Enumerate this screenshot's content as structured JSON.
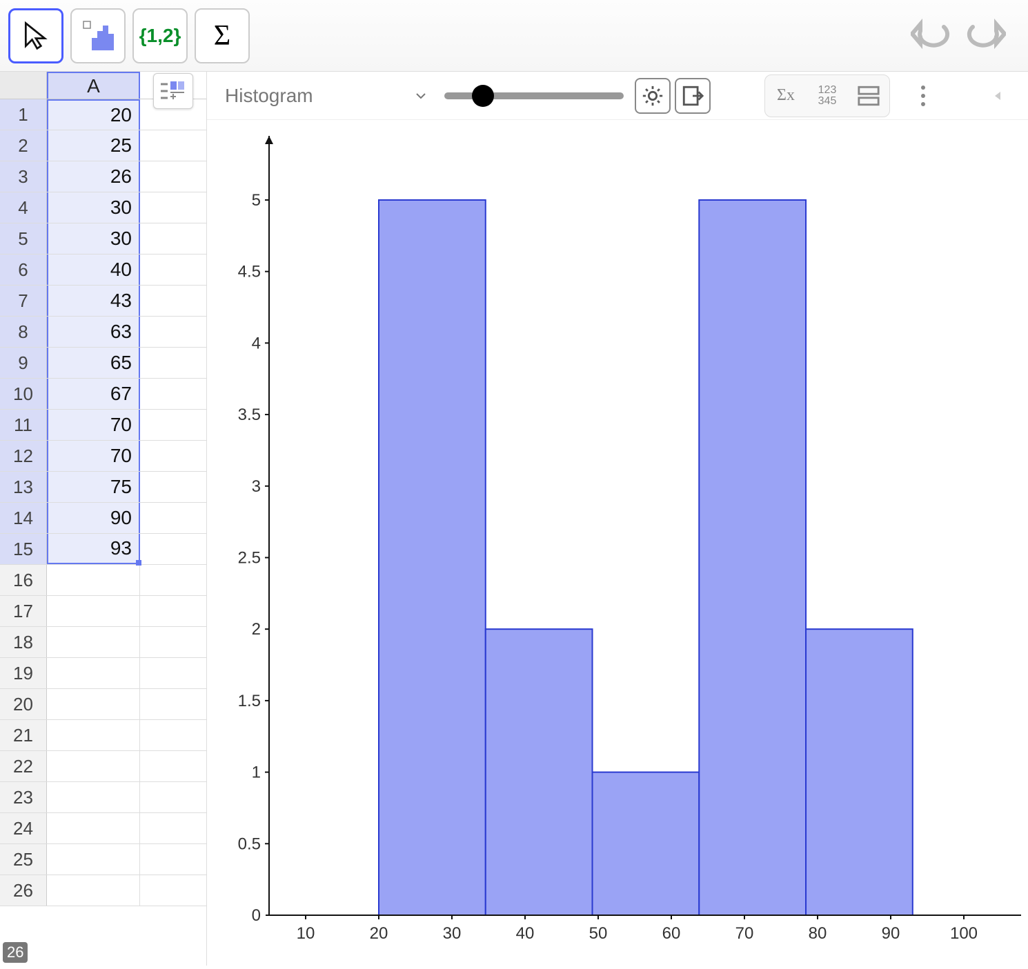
{
  "toolbar": {
    "move_tool": "move-tool",
    "histogram_tool": "one-variable-analysis",
    "list_tool": "{1,2}",
    "sigma_tool": "Σ"
  },
  "spreadsheet": {
    "column_header": "A",
    "visible_rows": 26,
    "selected_range_end": 15,
    "values": [
      20,
      25,
      26,
      30,
      30,
      40,
      43,
      63,
      65,
      67,
      70,
      70,
      75,
      90,
      93
    ],
    "row_tag": "26"
  },
  "chart_toolbar": {
    "dropdown_label": "Histogram"
  },
  "chart_data": {
    "type": "bar",
    "title": "",
    "xlabel": "",
    "ylabel": "",
    "x_ticks": [
      10,
      20,
      30,
      40,
      50,
      60,
      70,
      80,
      90,
      100
    ],
    "y_ticks": [
      0,
      0.5,
      1,
      1.5,
      2,
      2.5,
      3,
      3.5,
      4,
      4.5,
      5
    ],
    "xlim": [
      5,
      105
    ],
    "ylim": [
      0,
      5.4
    ],
    "bins": [
      {
        "x0": 20.0,
        "x1": 34.6,
        "count": 5
      },
      {
        "x0": 34.6,
        "x1": 49.2,
        "count": 2
      },
      {
        "x0": 49.2,
        "x1": 63.8,
        "count": 1
      },
      {
        "x0": 63.8,
        "x1": 78.4,
        "count": 5
      },
      {
        "x0": 78.4,
        "x1": 93.0,
        "count": 2
      }
    ]
  }
}
